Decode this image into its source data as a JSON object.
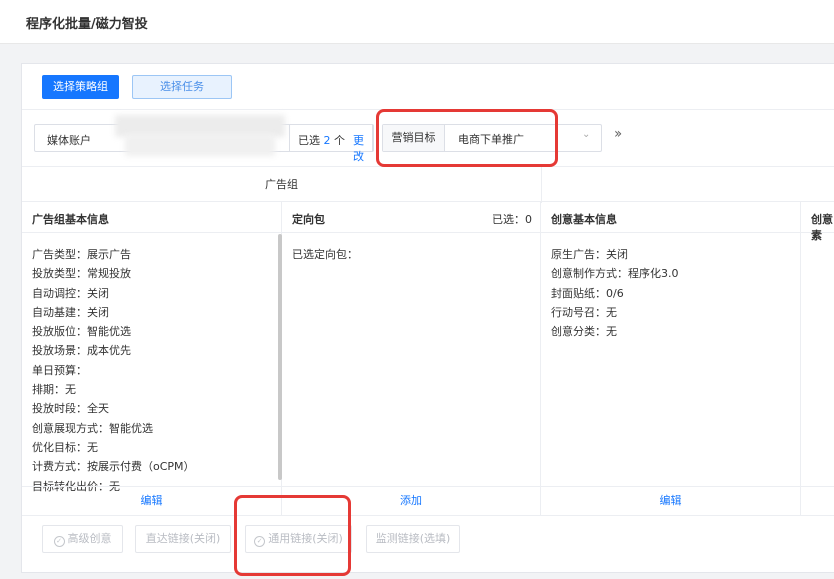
{
  "page": {
    "title": "程序化批量/磁力智投"
  },
  "toolbar": {
    "select_strategy_label": "选择策略组",
    "select_task_label": "选择任务"
  },
  "filters": {
    "media_account_label": "媒体账户",
    "selected_prefix": "已选",
    "selected_count": "2",
    "selected_suffix": "个",
    "change_label": "更改",
    "marketing_goal_label": "营销目标",
    "marketing_goal_value": "电商下单推广"
  },
  "group": {
    "title": "广告组"
  },
  "columns": {
    "basic": {
      "title": "广告组基本信息",
      "lines": [
        "广告类型：展示广告",
        "投放类型：常规投放",
        "自动调控：关闭",
        "自动基建：关闭",
        "投放版位：智能优选",
        "投放场景：成本优先",
        "单日预算：",
        "排期：无",
        "投放时段：全天",
        "创意展现方式：智能优选",
        "优化目标：无",
        "计费方式：按展示付费（oCPM）",
        "目标转化出价：无"
      ],
      "action": "编辑"
    },
    "targeting": {
      "title": "定向包",
      "count": "已选：0",
      "lines": [
        "已选定向包："
      ],
      "action": "添加"
    },
    "creative": {
      "title": "创意基本信息",
      "lines": [
        "原生广告：关闭",
        "创意制作方式：程序化3.0",
        "封面贴纸：0/6",
        "行动号召：无",
        "创意分类：无"
      ],
      "action": "编辑"
    },
    "extra": {
      "title": "创意素"
    }
  },
  "bottom_buttons": {
    "advanced_creative": "高级创意",
    "direct_link": "直达链接(关闭)",
    "general_link": "通用链接(关闭)",
    "monitor_link": "监测链接(选填)"
  },
  "colors": {
    "primary": "#1677ff",
    "highlight_box": "#e53935"
  }
}
